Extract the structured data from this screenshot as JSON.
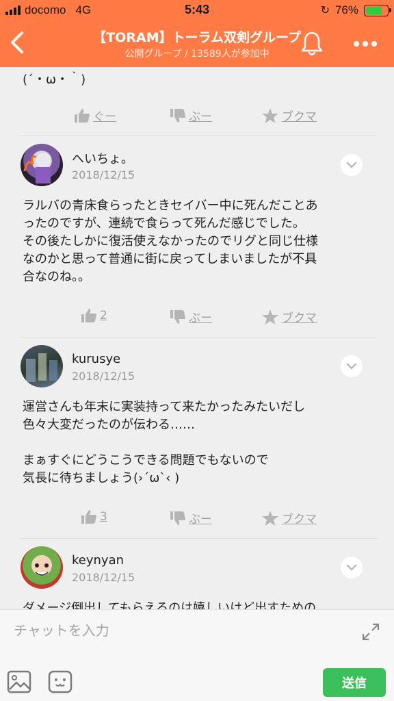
{
  "status_bar": {
    "carrier": "docomo",
    "network": "4G",
    "time": "5:43",
    "battery": "76%",
    "battery_level": 0.76
  },
  "header": {
    "title": "【TORAM】トーラム双剣グループ",
    "subtitle": "公開グループ / 13589人が参加中"
  },
  "top_text": "(´・ω・｀)",
  "actions_top": {
    "like": "ぐー",
    "dislike": "ぶー",
    "bookmark": "ブクマ"
  },
  "posts": [
    {
      "username": "へいちょ。",
      "date": "2018/12/15",
      "lines": [
        "ラルバの青床食らったときセイバー中に死んだことあ",
        "ったのですが、連続で食らって死んだ感じでした。",
        "その後たしかに復活使えなかったのでリグと同じ仕様",
        "なのかと思って普通に街に戻ってしまいましたが不具",
        "合なのね。。"
      ],
      "like": "2",
      "dislike": "ぶー",
      "bookmark": "ブクマ"
    },
    {
      "username": "kurusye",
      "date": "2018/12/15",
      "lines": [
        "運営さんも年末に実装持って来たかったみたいだし",
        "色々大変だったのが伝わる……",
        "",
        "まぁすぐにどうこうできる問題でもないので",
        "気長に待ちましょう(›´ω`‹ )"
      ],
      "like": "3",
      "dislike": "ぶー",
      "bookmark": "ブクマ"
    },
    {
      "username": "keynyan",
      "date": "2018/12/15",
      "lines": [
        "ダメージ倒出してもらえるのは嬉しいけど出すための"
      ]
    }
  ],
  "input": {
    "placeholder": "チャットを入力",
    "send_label": "送信"
  },
  "colors": {
    "brand": "#ff7a45",
    "send": "#3bbf5a"
  }
}
